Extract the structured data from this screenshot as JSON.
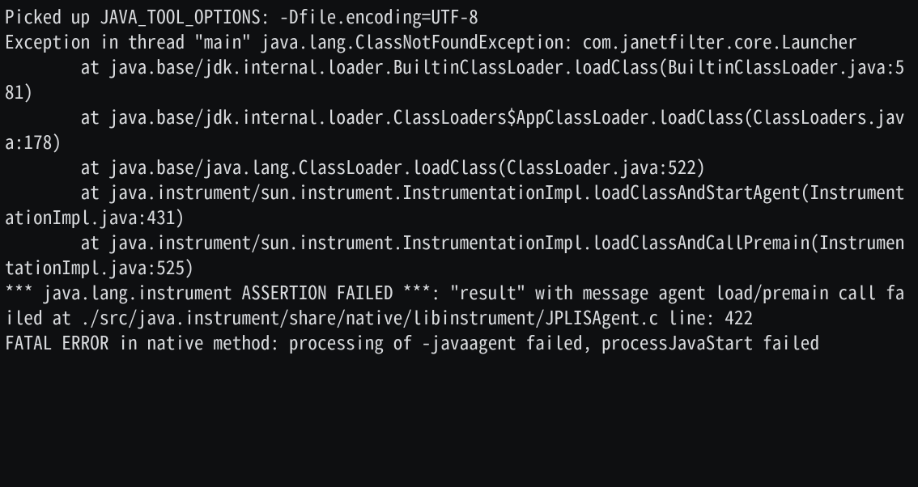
{
  "terminal": {
    "lines": [
      "Picked up JAVA_TOOL_OPTIONS: -Dfile.encoding=UTF-8",
      "Exception in thread \"main\" java.lang.ClassNotFoundException: com.janetfilter.core.Launcher",
      "        at java.base/jdk.internal.loader.BuiltinClassLoader.loadClass(BuiltinClassLoader.java:581)",
      "        at java.base/jdk.internal.loader.ClassLoaders$AppClassLoader.loadClass(ClassLoaders.java:178)",
      "        at java.base/java.lang.ClassLoader.loadClass(ClassLoader.java:522)",
      "        at java.instrument/sun.instrument.InstrumentationImpl.loadClassAndStartAgent(InstrumentationImpl.java:431)",
      "        at java.instrument/sun.instrument.InstrumentationImpl.loadClassAndCallPremain(InstrumentationImpl.java:525)",
      "*** java.lang.instrument ASSERTION FAILED ***: \"result\" with message agent load/premain call failed at ./src/java.instrument/share/native/libinstrument/JPLISAgent.c line: 422",
      "FATAL ERROR in native method: processing of -javaagent failed, processJavaStart failed"
    ]
  }
}
